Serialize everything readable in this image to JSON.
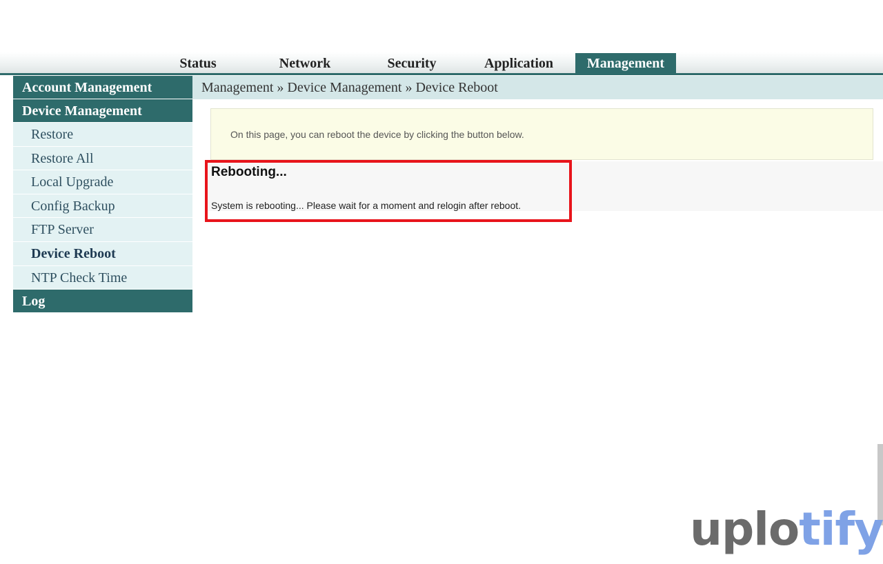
{
  "top_nav": {
    "tabs": [
      {
        "label": "Status"
      },
      {
        "label": "Network"
      },
      {
        "label": "Security"
      },
      {
        "label": "Application"
      },
      {
        "label": "Management",
        "active": true
      }
    ]
  },
  "sidebar": {
    "sections": [
      {
        "label": "Account Management"
      },
      {
        "label": "Device Management"
      }
    ],
    "items": [
      {
        "label": "Restore"
      },
      {
        "label": "Restore All"
      },
      {
        "label": "Local Upgrade"
      },
      {
        "label": "Config Backup"
      },
      {
        "label": "FTP Server"
      },
      {
        "label": "Device Reboot",
        "current": true
      },
      {
        "label": "NTP Check Time"
      }
    ],
    "log": {
      "label": "Log"
    }
  },
  "breadcrumb": "Management » Device Management » Device Reboot",
  "info_text": "On this page, you can reboot the device by clicking the button below.",
  "reboot": {
    "title": "Rebooting...",
    "message": "System is rebooting... Please wait for a moment and relogin after reboot."
  },
  "watermark": {
    "part1": "uplo",
    "part2": "tify"
  },
  "colors": {
    "accent": "#2e6b6b",
    "sidebar_item_bg": "#e3f2f3",
    "breadcrumb_bg": "#d4e7e8",
    "info_bg": "#fbfce6",
    "highlight": "#e8141b"
  }
}
